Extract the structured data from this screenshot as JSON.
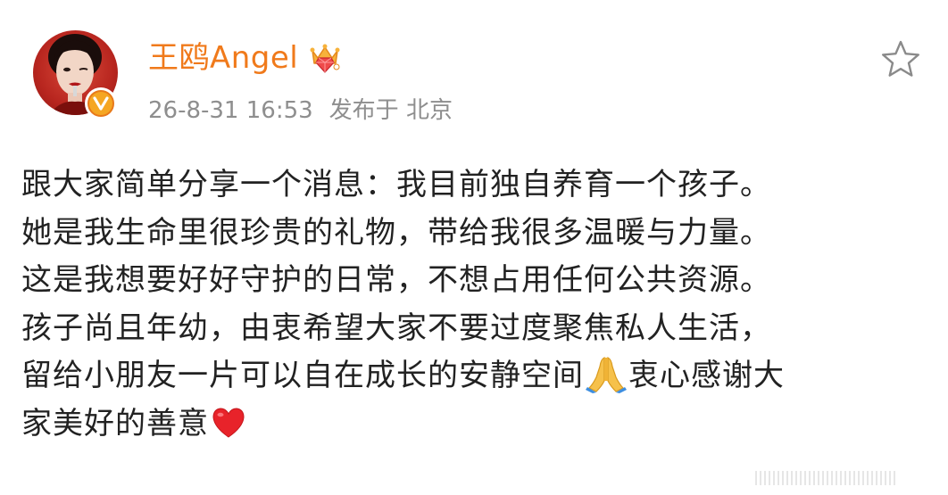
{
  "post": {
    "username": "王鸥Angel",
    "timestamp": "26-8-31 16:53",
    "location_prefix": "发布于",
    "location": "北京",
    "badge_icon": "verified-v-badge",
    "rank_icon": "crown-icon",
    "favorite_icon": "star-outline-icon",
    "lines": [
      "跟大家简单分享一个消息：我目前独自养育一个孩子。",
      "她是我生命里很珍贵的礼物，带给我很多温暖与力量。",
      "这是我想要好好守护的日常，不想占用任何公共资源。",
      "孩子尚且年幼，由衷希望大家不要过度聚焦私人生活，",
      "留给小朋友一片可以自在成长的安静空间",
      "衷心感谢大",
      "家美好的善意"
    ],
    "emoji": {
      "pray": "folded-hands-emoji",
      "heart": "red-heart-emoji"
    }
  },
  "colors": {
    "username": "#f07a1b",
    "meta": "#8e8e8e",
    "body_text": "#222222",
    "badge": "#f5a623"
  }
}
